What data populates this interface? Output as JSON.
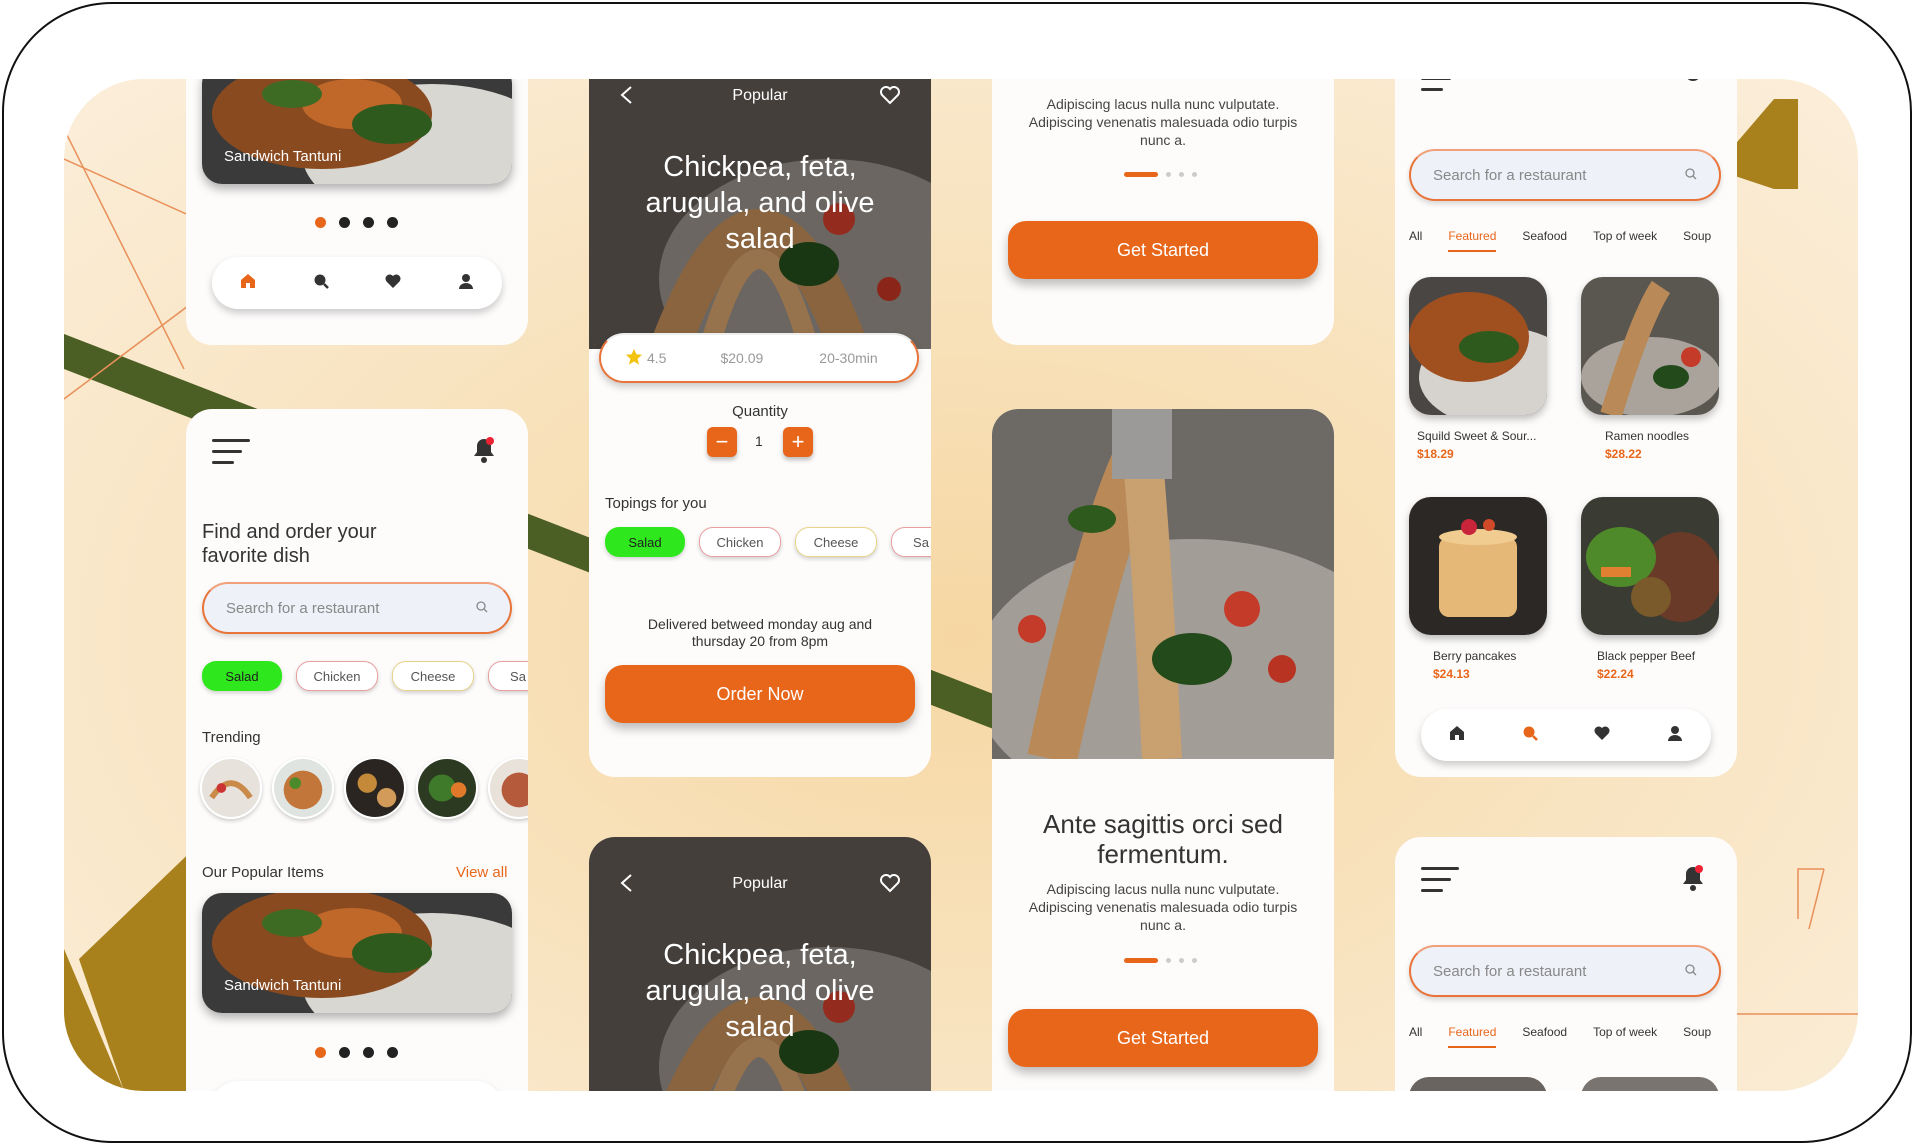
{
  "colors": {
    "accent": "#e8661a",
    "green": "#2ee81d",
    "olive": "#4b5e24",
    "mustard": "#a8801c"
  },
  "carousel_card": {
    "title": "Sandwich Tantuni",
    "dots": 4,
    "active_dot": 1
  },
  "nav_icons": [
    "home-icon",
    "search-icon",
    "heart-icon",
    "profile-icon"
  ],
  "home": {
    "headline_line1": "Find and order your",
    "headline_line2": "favorite dish",
    "search_placeholder": "Search for a restaurant",
    "chips": [
      "Salad",
      "Chicken",
      "Cheese",
      "Sa"
    ],
    "trending_label": "Trending",
    "popular_label": "Our Popular Items",
    "view_all": "View all",
    "popular_item": "Sandwich Tantuni"
  },
  "detail": {
    "category": "Popular",
    "title_line1": "Chickpea, feta,",
    "title_line2": "arugula, and olive",
    "title_line3": "salad",
    "rating": "4.5",
    "price": "$20.09",
    "time": "20-30min",
    "quantity_label": "Quantity",
    "quantity": "1",
    "minus": "−",
    "plus": "+",
    "toppings_label": "Topings for you",
    "toppings": [
      "Salad",
      "Chicken",
      "Cheese",
      "Sa"
    ],
    "delivery_line1": "Delivered betweed monday aug and",
    "delivery_line2": "thursday 20 from 8pm",
    "order_button": "Order Now"
  },
  "onboarding": {
    "body_line1": "Adipiscing lacus nulla nunc vulputate.",
    "body_line2": "Adipiscing venenatis malesuada odio turpis",
    "body_line3": "nunc a.",
    "heading_line1": "Ante sagittis orci sed",
    "heading_line2": "fermentum.",
    "cta": "Get Started",
    "pages": 4,
    "active_page": 1
  },
  "browse": {
    "search_placeholder": "Search for a restaurant",
    "tabs": [
      "All",
      "Featured",
      "Seafood",
      "Top of week",
      "Soup"
    ],
    "active_tab": "Featured",
    "items": [
      {
        "name": "Squild Sweet & Sour...",
        "price": "$18.29"
      },
      {
        "name": "Ramen noodles",
        "price": "$28.22"
      },
      {
        "name": "Berry pancakes",
        "price": "$24.13"
      },
      {
        "name": "Black pepper Beef",
        "price": "$22.24"
      }
    ]
  }
}
